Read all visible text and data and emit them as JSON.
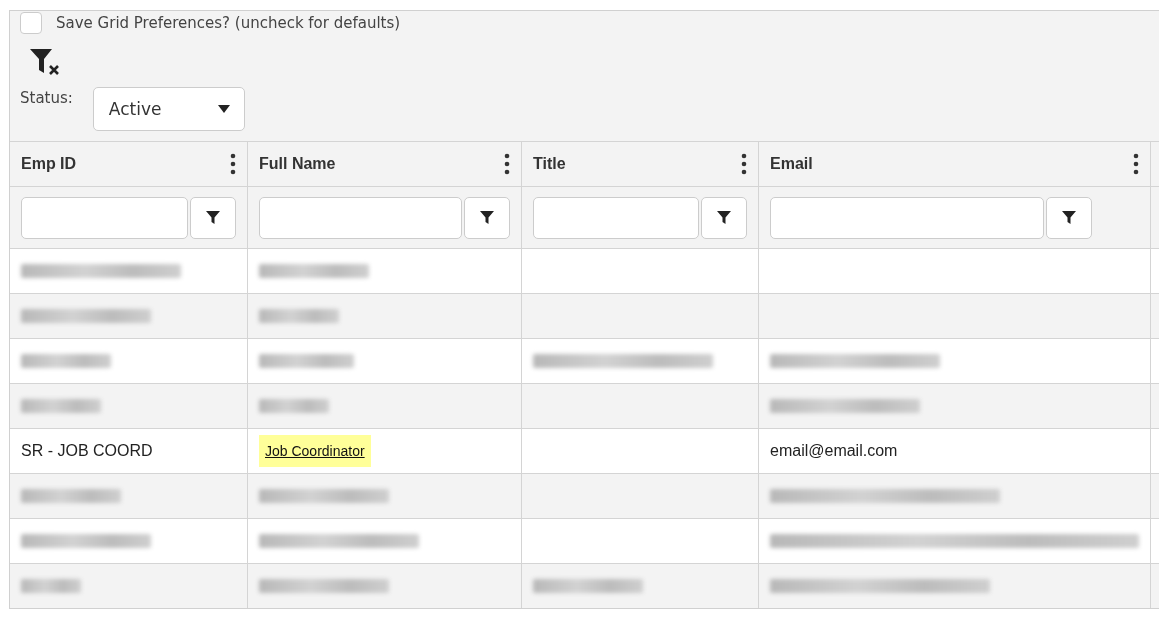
{
  "save_preferences": {
    "label": "Save Grid Preferences? (uncheck for defaults)",
    "checked": false
  },
  "status_filter": {
    "label": "Status:",
    "value": "Active"
  },
  "table": {
    "columns": [
      {
        "label": "Emp ID"
      },
      {
        "label": "Full Name"
      },
      {
        "label": "Title"
      },
      {
        "label": "Email"
      }
    ],
    "rows": [
      {
        "cells": [
          {
            "kind": "redacted"
          },
          {
            "kind": "redacted"
          },
          {
            "kind": "empty"
          },
          {
            "kind": "empty"
          }
        ]
      },
      {
        "cells": [
          {
            "kind": "redacted"
          },
          {
            "kind": "redacted"
          },
          {
            "kind": "empty"
          },
          {
            "kind": "empty"
          }
        ]
      },
      {
        "cells": [
          {
            "kind": "redacted"
          },
          {
            "kind": "redacted"
          },
          {
            "kind": "redacted"
          },
          {
            "kind": "redacted"
          }
        ]
      },
      {
        "cells": [
          {
            "kind": "redacted"
          },
          {
            "kind": "redacted"
          },
          {
            "kind": "empty"
          },
          {
            "kind": "redacted"
          }
        ]
      },
      {
        "cells": [
          {
            "kind": "text",
            "text": "SR - JOB COORD"
          },
          {
            "kind": "link",
            "text": "Job Coordinator"
          },
          {
            "kind": "empty"
          },
          {
            "kind": "text",
            "text": "email@email.com"
          }
        ]
      },
      {
        "cells": [
          {
            "kind": "redacted"
          },
          {
            "kind": "redacted"
          },
          {
            "kind": "empty"
          },
          {
            "kind": "redacted"
          }
        ]
      },
      {
        "cells": [
          {
            "kind": "redacted"
          },
          {
            "kind": "redacted"
          },
          {
            "kind": "empty"
          },
          {
            "kind": "redacted"
          }
        ]
      },
      {
        "cells": [
          {
            "kind": "redacted"
          },
          {
            "kind": "redacted"
          },
          {
            "kind": "redacted"
          },
          {
            "kind": "redacted"
          }
        ]
      }
    ]
  }
}
